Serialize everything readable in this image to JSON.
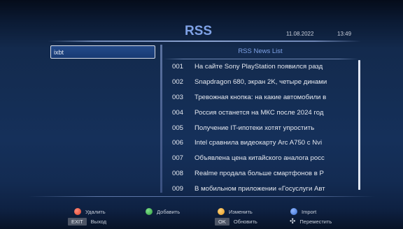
{
  "header": {
    "title": "RSS",
    "date": "11.08.2022",
    "time": "13:49"
  },
  "feeds": {
    "selected": "ixbt"
  },
  "news": {
    "title": "RSS News List",
    "rows": [
      {
        "num": "001",
        "text": "На сайте Sony PlayStation появился разд"
      },
      {
        "num": "002",
        "text": "Snapdragon 680, экран 2K, четыре динами"
      },
      {
        "num": "003",
        "text": "Тревожная кнопка: на какие автомобили в"
      },
      {
        "num": "004",
        "text": "Россия останется на МКС после 2024 год"
      },
      {
        "num": "005",
        "text": "Получение IT-ипотеки хотят упростить"
      },
      {
        "num": "006",
        "text": "Intel сравнила видеокарту Arc A750 с Nvi"
      },
      {
        "num": "007",
        "text": "Объявлена цена китайского аналога росс"
      },
      {
        "num": "008",
        "text": "Realme продала больше смартфонов в Р"
      },
      {
        "num": "009",
        "text": "В мобильном приложении «Госуслуги Авт"
      }
    ]
  },
  "footer": {
    "delete_label": "Удалить",
    "add_label": "Добавить",
    "edit_label": "Изменить",
    "import_label": "Import",
    "exit_key": "EXIT",
    "exit_label": "Выход",
    "ok_key": "OK",
    "ok_label": "Обновить",
    "move_label": "Переместить"
  },
  "colors": {
    "red": "#e0452f",
    "green": "#2f9c3f",
    "yellow": "#e69a1e",
    "blue": "#3a6fd0"
  },
  "icons": {
    "delete": "red-dot-icon",
    "add": "green-dot-icon",
    "edit": "yellow-dot-icon",
    "import": "blue-dot-icon",
    "move": "move-arrows-icon"
  }
}
